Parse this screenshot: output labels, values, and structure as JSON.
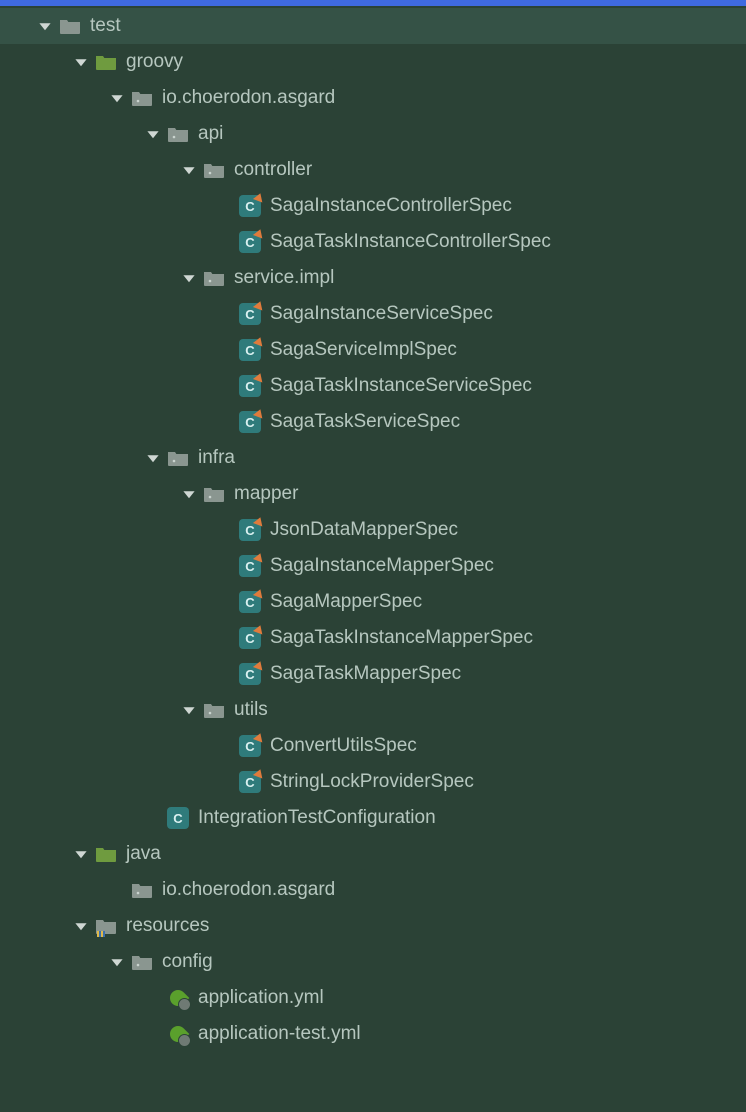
{
  "tree": {
    "test": "test",
    "groovy": "groovy",
    "pkg_asgard": "io.choerodon.asgard",
    "api": "api",
    "controller": "controller",
    "ctrl_files": [
      "SagaInstanceControllerSpec",
      "SagaTaskInstanceControllerSpec"
    ],
    "service_impl": "service.impl",
    "svc_files": [
      "SagaInstanceServiceSpec",
      "SagaServiceImplSpec",
      "SagaTaskInstanceServiceSpec",
      "SagaTaskServiceSpec"
    ],
    "infra": "infra",
    "mapper": "mapper",
    "mapper_files": [
      "JsonDataMapperSpec",
      "SagaInstanceMapperSpec",
      "SagaMapperSpec",
      "SagaTaskInstanceMapperSpec",
      "SagaTaskMapperSpec"
    ],
    "utils": "utils",
    "utils_files": [
      "ConvertUtilsSpec",
      "StringLockProviderSpec"
    ],
    "itc": "IntegrationTestConfiguration",
    "java": "java",
    "java_pkg": "io.choerodon.asgard",
    "resources": "resources",
    "config": "config",
    "yml_files": [
      "application.yml",
      "application-test.yml"
    ]
  }
}
